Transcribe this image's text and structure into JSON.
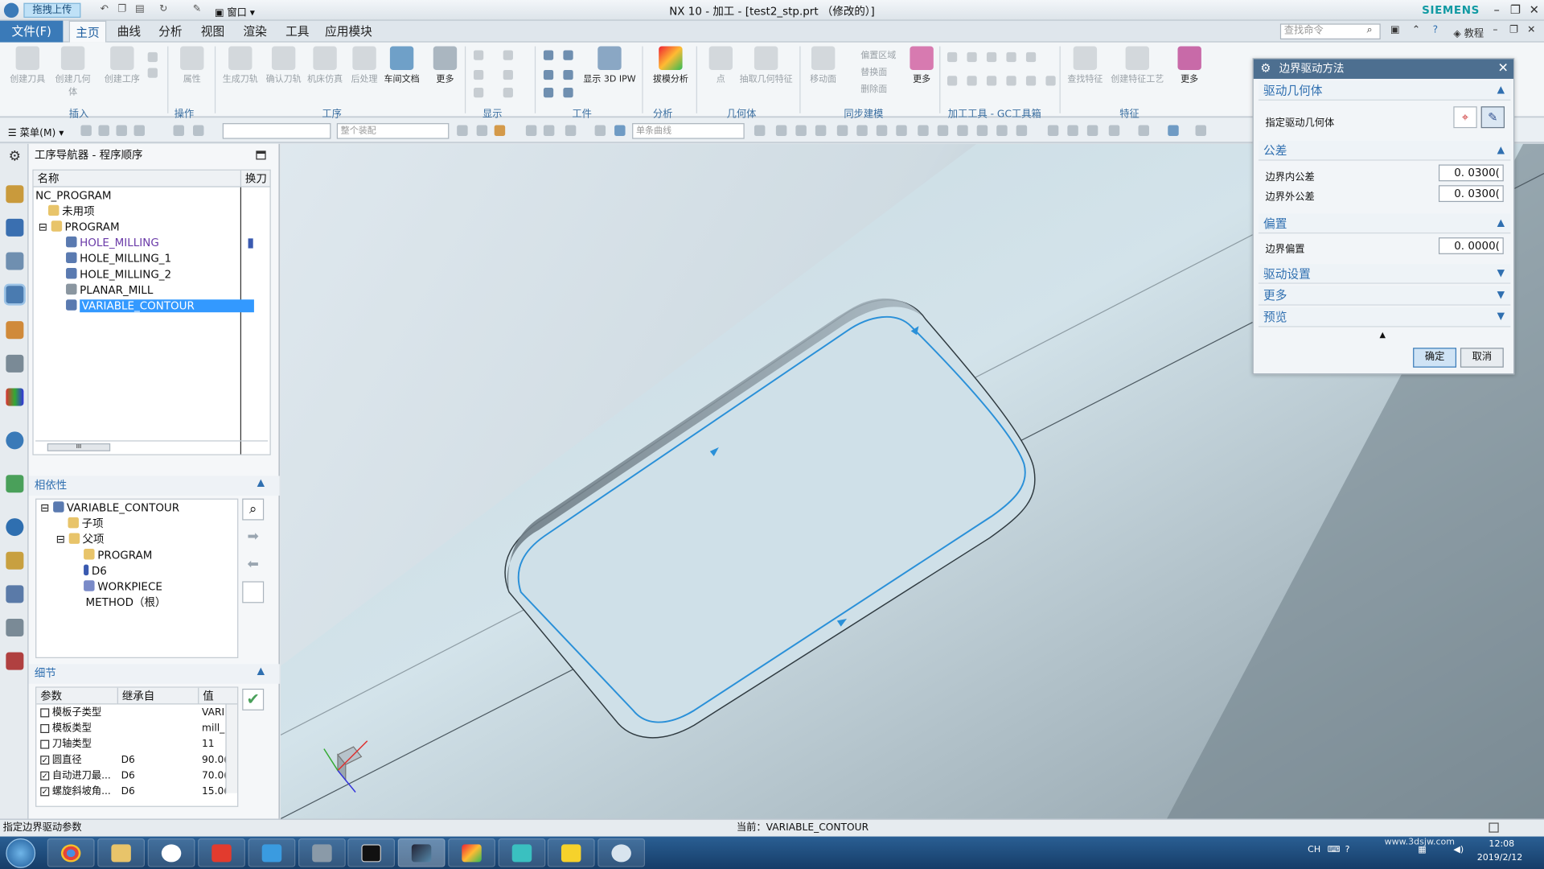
{
  "titlebar": {
    "title": "NX 10 - 加工 - [test2_stp.prt （修改的）]",
    "upload": "拖拽上传",
    "window": "窗口",
    "brand": "SIEMENS"
  },
  "menu": {
    "file": "文件(F)",
    "tabs": [
      "主页",
      "曲线",
      "分析",
      "视图",
      "渲染",
      "工具",
      "应用模块"
    ],
    "search_placeholder": "查找命令",
    "tutorial": "教程"
  },
  "ribbon": {
    "buttons": [
      "创建刀具",
      "创建几何体",
      "创建工序",
      "属性",
      "生成刀轨",
      "确认刀轨",
      "机床仿真",
      "后处理",
      "车间文档",
      "更多",
      "显示 3D IPW",
      "拔模分析",
      "点",
      "抽取几何特征",
      "移动面",
      "更多",
      "查找特征",
      "创建特征工艺",
      "更多"
    ],
    "small": [
      "偏置区域",
      "替换面",
      "删除面"
    ],
    "groups": [
      "插入",
      "操作",
      "工序",
      "显示",
      "工件",
      "分析",
      "几何体",
      "同步建模",
      "加工工具 - GC工具箱",
      "特征"
    ]
  },
  "cmdbar": {
    "menu": "菜单(M)",
    "assembly": "整个装配",
    "curve": "单条曲线"
  },
  "navigator": {
    "title": "工序导航器 - 程序顺序",
    "columns": [
      "名称",
      "换刀"
    ],
    "rows": [
      "NC_PROGRAM",
      "未用项",
      "PROGRAM",
      "HOLE_MILLING",
      "HOLE_MILLING_1",
      "HOLE_MILLING_2",
      "PLANAR_MILL",
      "VARIABLE_CONTOUR"
    ],
    "scroll_mark": "III"
  },
  "dependencies": {
    "title": "相依性",
    "rows": [
      "VARIABLE_CONTOUR",
      "子项",
      "父项",
      "PROGRAM",
      "D6",
      "WORKPIECE",
      "METHOD（根）"
    ]
  },
  "details": {
    "title": "细节",
    "columns": [
      "参数",
      "继承自",
      "值"
    ],
    "rows": [
      {
        "param": "模板子类型",
        "from": "",
        "value": "VARI"
      },
      {
        "param": "模板类型",
        "from": "",
        "value": "mill_"
      },
      {
        "param": "刀轴类型",
        "from": "",
        "value": "11"
      },
      {
        "param": "圆直径",
        "from": "D6",
        "value": "90.0("
      },
      {
        "param": "自动进刀最...",
        "from": "D6",
        "value": "70.0("
      },
      {
        "param": "螺旋斜坡角...",
        "from": "D6",
        "value": "15.0("
      }
    ]
  },
  "dialog": {
    "title": "边界驱动方法",
    "sections": {
      "drive_geometry": "驱动几何体",
      "tolerance": "公差",
      "offset": "偏置",
      "drive_settings": "驱动设置",
      "more": "更多",
      "preview": "预览"
    },
    "specify_label": "指定驱动几何体",
    "inner_tol_label": "边界内公差",
    "inner_tol": "0. 0300(",
    "outer_tol_label": "边界外公差",
    "outer_tol": "0. 0300(",
    "offset_label": "边界偏置",
    "offset": "0. 0000(",
    "ok": "确定",
    "cancel": "取消"
  },
  "status": {
    "left": "指定边界驱动参数",
    "center": "当前：VARIABLE_CONTOUR"
  },
  "taskbar": {
    "lang": "CH",
    "time": "12:08",
    "date": "2019/2/12",
    "watermark": "www.3dsjw.com"
  },
  "colors": {
    "accent": "#3a7ab8",
    "selection": "#3399ff",
    "toolpath": "#2a90d8",
    "brand": "#119aa3"
  }
}
